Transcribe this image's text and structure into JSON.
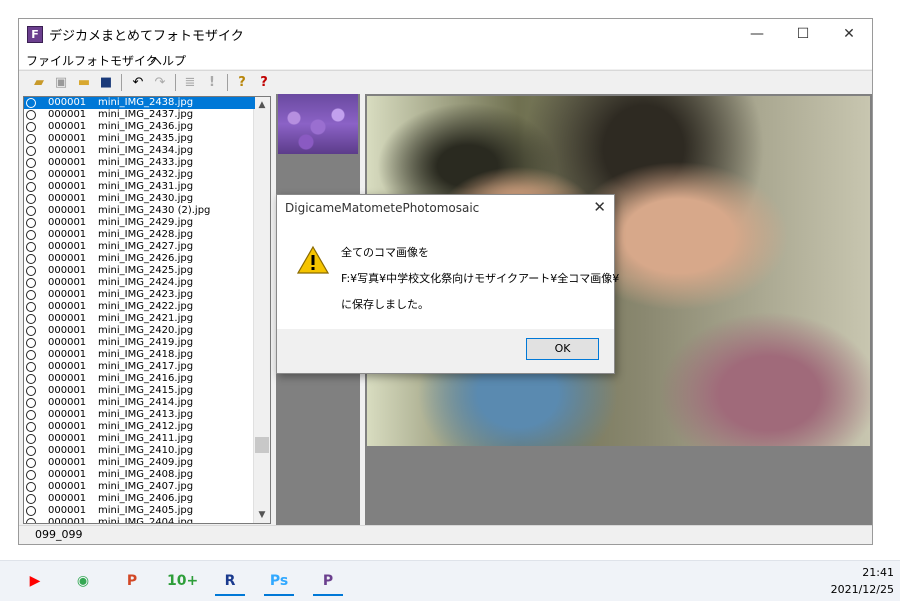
{
  "window": {
    "title": "デジカメまとめてフォトモザイク",
    "app_icon_letter": "F",
    "minimize": "—",
    "maximize": "☐",
    "close": "✕"
  },
  "menu": [
    "ファイル",
    "フォトモザイク",
    "ヘルプ"
  ],
  "toolbar_icons": [
    "open-folder-icon",
    "image-icon",
    "folder-icon",
    "save-icon",
    "undo-icon",
    "redo-icon",
    "list-icon",
    "exclamation-icon",
    "help-icon",
    "context-help-icon"
  ],
  "file_list": {
    "selected_index": 0,
    "items": [
      {
        "num": "000001",
        "name": "mini_IMG_2438.jpg"
      },
      {
        "num": "000001",
        "name": "mini_IMG_2437.jpg"
      },
      {
        "num": "000001",
        "name": "mini_IMG_2436.jpg"
      },
      {
        "num": "000001",
        "name": "mini_IMG_2435.jpg"
      },
      {
        "num": "000001",
        "name": "mini_IMG_2434.jpg"
      },
      {
        "num": "000001",
        "name": "mini_IMG_2433.jpg"
      },
      {
        "num": "000001",
        "name": "mini_IMG_2432.jpg"
      },
      {
        "num": "000001",
        "name": "mini_IMG_2431.jpg"
      },
      {
        "num": "000001",
        "name": "mini_IMG_2430.jpg"
      },
      {
        "num": "000001",
        "name": "mini_IMG_2430 (2).jpg"
      },
      {
        "num": "000001",
        "name": "mini_IMG_2429.jpg"
      },
      {
        "num": "000001",
        "name": "mini_IMG_2428.jpg"
      },
      {
        "num": "000001",
        "name": "mini_IMG_2427.jpg"
      },
      {
        "num": "000001",
        "name": "mini_IMG_2426.jpg"
      },
      {
        "num": "000001",
        "name": "mini_IMG_2425.jpg"
      },
      {
        "num": "000001",
        "name": "mini_IMG_2424.jpg"
      },
      {
        "num": "000001",
        "name": "mini_IMG_2423.jpg"
      },
      {
        "num": "000001",
        "name": "mini_IMG_2422.jpg"
      },
      {
        "num": "000001",
        "name": "mini_IMG_2421.jpg"
      },
      {
        "num": "000001",
        "name": "mini_IMG_2420.jpg"
      },
      {
        "num": "000001",
        "name": "mini_IMG_2419.jpg"
      },
      {
        "num": "000001",
        "name": "mini_IMG_2418.jpg"
      },
      {
        "num": "000001",
        "name": "mini_IMG_2417.jpg"
      },
      {
        "num": "000001",
        "name": "mini_IMG_2416.jpg"
      },
      {
        "num": "000001",
        "name": "mini_IMG_2415.jpg"
      },
      {
        "num": "000001",
        "name": "mini_IMG_2414.jpg"
      },
      {
        "num": "000001",
        "name": "mini_IMG_2413.jpg"
      },
      {
        "num": "000001",
        "name": "mini_IMG_2412.jpg"
      },
      {
        "num": "000001",
        "name": "mini_IMG_2411.jpg"
      },
      {
        "num": "000001",
        "name": "mini_IMG_2410.jpg"
      },
      {
        "num": "000001",
        "name": "mini_IMG_2409.jpg"
      },
      {
        "num": "000001",
        "name": "mini_IMG_2408.jpg"
      },
      {
        "num": "000001",
        "name": "mini_IMG_2407.jpg"
      },
      {
        "num": "000001",
        "name": "mini_IMG_2406.jpg"
      },
      {
        "num": "000001",
        "name": "mini_IMG_2405.jpg"
      },
      {
        "num": "000001",
        "name": "mini_IMG_2404.jpg"
      }
    ]
  },
  "status": "099_099",
  "dialog": {
    "title": "DigicameMatometePhotomosaic",
    "close": "✕",
    "line1": "全てのコマ画像を",
    "line2": "F:¥写真¥中学校文化祭向けモザイクアート¥全コマ画像¥",
    "line3": "に保存しました。",
    "ok_label": "OK"
  },
  "taskbar": {
    "apps": [
      {
        "icon": "youtube-icon",
        "glyph": "▶",
        "color": "#ff0000"
      },
      {
        "icon": "chrome-icon",
        "glyph": "◉",
        "color": "#34a853"
      },
      {
        "icon": "powerpoint-icon",
        "glyph": "P",
        "color": "#d24726"
      },
      {
        "icon": "app-10plus-icon",
        "glyph": "10+",
        "color": "#2e9e3a"
      },
      {
        "icon": "app-r-icon",
        "glyph": "R",
        "color": "#1a3a8e"
      },
      {
        "icon": "photoshop-icon",
        "glyph": "Ps",
        "color": "#31a8ff"
      },
      {
        "icon": "app-p-icon",
        "glyph": "P",
        "color": "#6b3f8e"
      }
    ],
    "time": "21:41",
    "date": "2021/12/25"
  }
}
